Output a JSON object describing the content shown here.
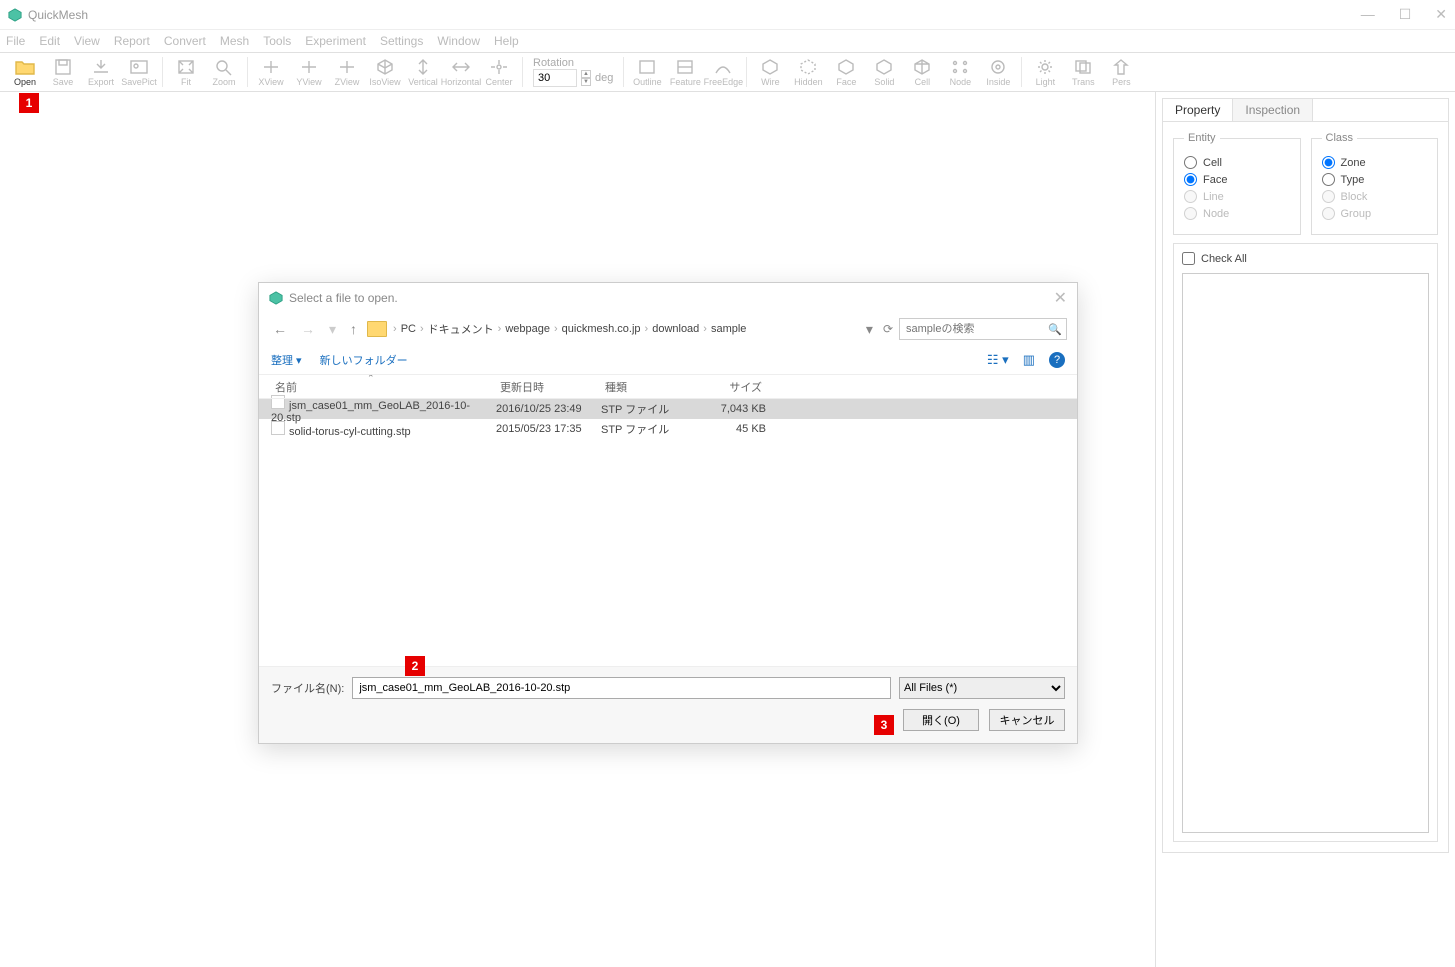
{
  "app": {
    "title": "QuickMesh"
  },
  "window_controls": {
    "min": "—",
    "max": "☐",
    "close": "✕"
  },
  "menu": [
    "File",
    "Edit",
    "View",
    "Report",
    "Convert",
    "Mesh",
    "Tools",
    "Experiment",
    "Settings",
    "Window",
    "Help"
  ],
  "toolbar": {
    "groups": [
      [
        "Open",
        "Save",
        "Export",
        "SavePict"
      ],
      [
        "Fit",
        "Zoom"
      ],
      [
        "XView",
        "YView",
        "ZView",
        "IsoView",
        "Vertical",
        "Horizontal",
        "Center"
      ],
      [
        "Outline",
        "Feature",
        "FreeEdge"
      ],
      [
        "Wire",
        "Hidden",
        "Face",
        "Solid",
        "Cell",
        "Node",
        "Inside"
      ],
      [
        "Light",
        "Trans",
        "Pers"
      ]
    ],
    "rotation": {
      "label": "Rotation",
      "value": "30",
      "unit": "deg"
    }
  },
  "side": {
    "tabs": [
      "Property",
      "Inspection"
    ],
    "active_tab": 0,
    "entity": {
      "legend": "Entity",
      "options": [
        "Cell",
        "Face",
        "Line",
        "Node"
      ],
      "selected": "Face",
      "disabled": [
        "Line",
        "Node"
      ]
    },
    "class": {
      "legend": "Class",
      "options": [
        "Zone",
        "Type",
        "Block",
        "Group"
      ],
      "selected": "Zone",
      "disabled": [
        "Block",
        "Group"
      ]
    },
    "checkall_label": "Check All"
  },
  "annotations": {
    "one": "1",
    "two": "2",
    "three": "3"
  },
  "dialog": {
    "title": "Select a file to open.",
    "breadcrumb": [
      "PC",
      "ドキュメント",
      "webpage",
      "quickmesh.co.jp",
      "download",
      "sample"
    ],
    "search_placeholder": "sampleの検索",
    "toolbar": {
      "organize": "整理",
      "newfolder": "新しいフォルダー"
    },
    "columns": {
      "name": "名前",
      "date": "更新日時",
      "type": "種類",
      "size": "サイズ"
    },
    "files": [
      {
        "name": "jsm_case01_mm_GeoLAB_2016-10-20.stp",
        "date": "2016/10/25 23:49",
        "type": "STP ファイル",
        "size": "7,043 KB",
        "selected": true
      },
      {
        "name": "solid-torus-cyl-cutting.stp",
        "date": "2015/05/23 17:35",
        "type": "STP ファイル",
        "size": "45 KB",
        "selected": false
      }
    ],
    "filename_label": "ファイル名(N):",
    "filename_value": "jsm_case01_mm_GeoLAB_2016-10-20.stp",
    "filter": "All Files (*)",
    "open_btn": "開く(O)",
    "cancel_btn": "キャンセル"
  }
}
